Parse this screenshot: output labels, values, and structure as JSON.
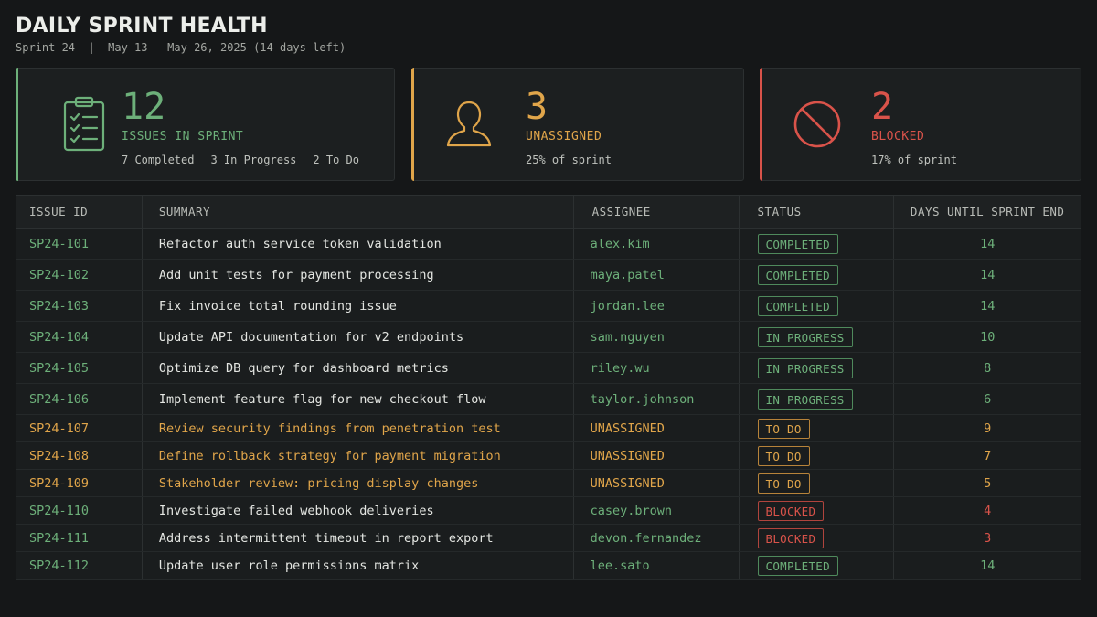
{
  "header": {
    "title": "DAILY SPRINT HEALTH",
    "subtitle": "Sprint 24  |  May 13 – May 26, 2025 (14 days left)"
  },
  "cards": {
    "issues": {
      "value": "12",
      "label": "ISSUES IN SPRINT",
      "completed": "7 Completed",
      "in_progress": "3 In Progress",
      "todo": "2 To Do",
      "color": "#6db07a",
      "icon": "clipboard-checklist-icon"
    },
    "unassigned": {
      "value": "3",
      "label": "UNASSIGNED",
      "sub": "25% of sprint",
      "color": "#e0a54a",
      "icon": "user-icon"
    },
    "blocked": {
      "value": "2",
      "label": "BLOCKED",
      "sub": "17% of sprint",
      "color": "#d9534a",
      "icon": "blocked-icon"
    }
  },
  "table": {
    "columns": [
      "ISSUE ID",
      "SUMMARY",
      "ASSIGNEE",
      "STATUS",
      "DAYS UNTIL SPRINT END"
    ],
    "rows": [
      {
        "id": "SP24-101",
        "summary": "Refactor auth service token validation",
        "assignee": "alex.kim",
        "status": "COMPLETED",
        "days": "14"
      },
      {
        "id": "SP24-102",
        "summary": "Add unit tests for payment processing",
        "assignee": "maya.patel",
        "status": "COMPLETED",
        "days": "14"
      },
      {
        "id": "SP24-103",
        "summary": "Fix invoice total rounding issue",
        "assignee": "jordan.lee",
        "status": "COMPLETED",
        "days": "14"
      },
      {
        "id": "SP24-104",
        "summary": "Update API documentation for v2 endpoints",
        "assignee": "sam.nguyen",
        "status": "IN PROGRESS",
        "days": "10"
      },
      {
        "id": "SP24-105",
        "summary": "Optimize DB query for dashboard metrics",
        "assignee": "riley.wu",
        "status": "IN PROGRESS",
        "days": "8"
      },
      {
        "id": "SP24-106",
        "summary": "Implement feature flag for new checkout flow",
        "assignee": "taylor.johnson",
        "status": "IN PROGRESS",
        "days": "6"
      },
      {
        "id": "SP24-107",
        "summary": "Review security findings from penetration test",
        "assignee": "UNASSIGNED",
        "status": "TO DO",
        "days": "9"
      },
      {
        "id": "SP24-108",
        "summary": "Define rollback strategy for payment migration",
        "assignee": "UNASSIGNED",
        "status": "TO DO",
        "days": "7"
      },
      {
        "id": "SP24-109",
        "summary": "Stakeholder review: pricing display changes",
        "assignee": "UNASSIGNED",
        "status": "TO DO",
        "days": "5"
      },
      {
        "id": "SP24-110",
        "summary": "Investigate failed webhook deliveries",
        "assignee": "casey.brown",
        "status": "BLOCKED",
        "days": "4"
      },
      {
        "id": "SP24-111",
        "summary": "Address intermittent timeout in report export",
        "assignee": "devon.fernandez",
        "status": "BLOCKED",
        "days": "3"
      },
      {
        "id": "SP24-112",
        "summary": "Update user role permissions matrix",
        "assignee": "lee.sato",
        "status": "COMPLETED",
        "days": "14"
      }
    ]
  }
}
